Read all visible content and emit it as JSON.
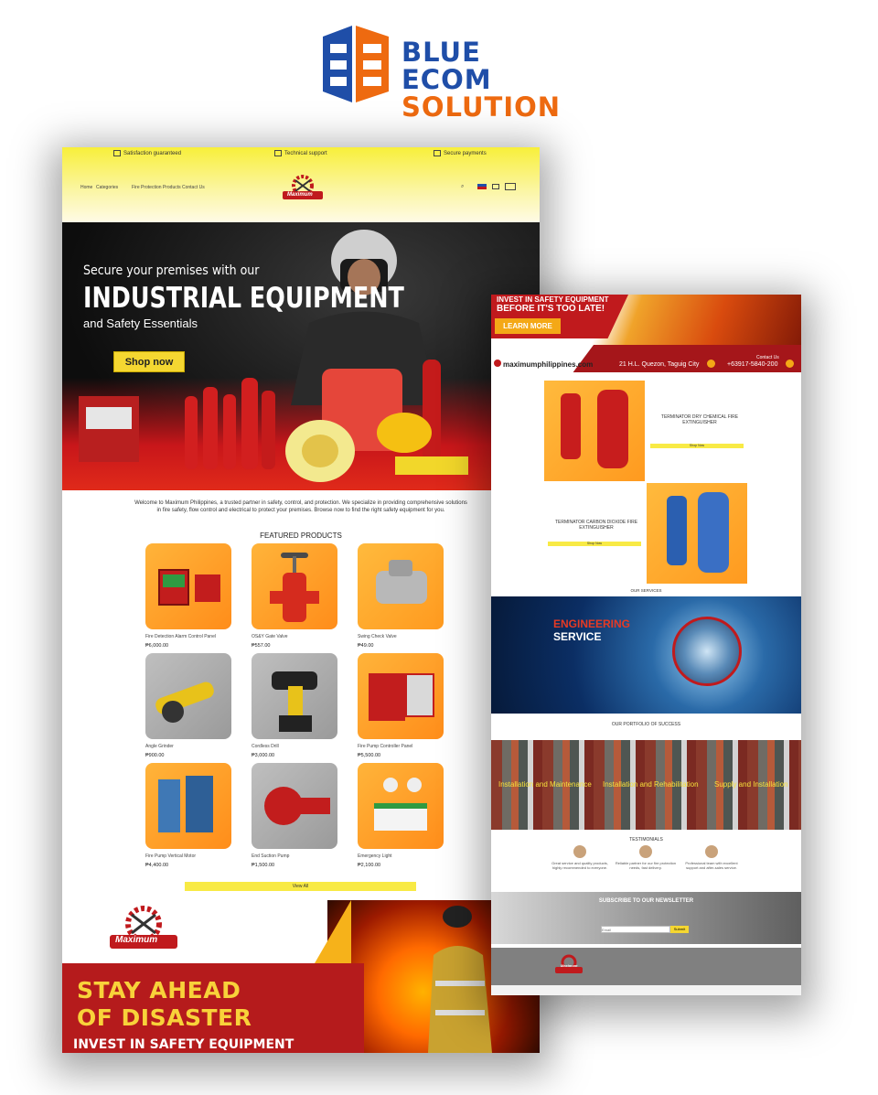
{
  "brand": {
    "line1": "BLUE ECOM",
    "line2": "SOLUTION",
    "color_blue": "#1f4ea8",
    "color_orange": "#ee6a10"
  },
  "left_page": {
    "trust_bar": [
      "Satisfaction guaranteed",
      "Technical support",
      "Secure payments"
    ],
    "nav": [
      "Home",
      "Categories",
      "Fire Protection Products",
      "Contact Us"
    ],
    "logo_text": "Maximum",
    "hero": {
      "line1": "Secure your premises with our",
      "line2": "INDUSTRIAL EQUIPMENT",
      "line3": "and Safety Essentials",
      "button": "Shop now"
    },
    "welcome": "Welcome to Maximum Philippines, a trusted partner in safety, control, and protection. We specialize in providing comprehensive solutions in fire safety, flow control and electrical to protect your premises. Browse now to find the right safety equipment for you.",
    "featured_title": "FEATURED PRODUCTS",
    "products": [
      {
        "name": "Fire Detection Alarm Control Panel",
        "price": "₱6,000.00",
        "icon": "alarm-panel-icon",
        "grey": false
      },
      {
        "name": "OS&Y Gate Valve",
        "price": "₱557.00",
        "icon": "gate-valve-icon",
        "grey": false
      },
      {
        "name": "Swing Check Valve",
        "price": "₱49.00",
        "icon": "check-valve-icon",
        "grey": true
      },
      {
        "name": "Angle Grinder",
        "price": "₱900.00",
        "icon": "grinder-icon",
        "grey": true
      },
      {
        "name": "Cordless Drill",
        "price": "₱3,000.00",
        "icon": "drill-icon",
        "grey": true
      },
      {
        "name": "Fire Pump Controller Panel",
        "price": "₱5,500.00",
        "icon": "pump-panel-icon",
        "grey": false
      },
      {
        "name": "Fire Pump Vertical Motor",
        "price": "₱4,400.00",
        "icon": "motor-icon",
        "grey": false
      },
      {
        "name": "End Suction Pump",
        "price": "₱1,500.00",
        "icon": "pump-icon",
        "grey": true
      },
      {
        "name": "Emergency Light",
        "price": "₱2,100.00",
        "icon": "emergency-light-icon",
        "grey": false
      }
    ],
    "view_all": "View All",
    "footer_banner": {
      "logo": "Maximum",
      "line1": "STAY AHEAD",
      "line2": "OF DISASTER",
      "line3": "INVEST IN SAFETY EQUIPMENT"
    }
  },
  "right_page": {
    "hero": {
      "line1": "INVEST IN SAFETY EQUIPMENT",
      "line2": "BEFORE IT'S TOO LATE!",
      "button": "LEARN MORE"
    },
    "contact": {
      "email": "maximumphilippines.com",
      "address": "21 H.L. Quezon, Taguig City",
      "contact_us": "Contact Us",
      "phone": "+63917-5840-200"
    },
    "product1": {
      "title": "TERMINATOR DRY CHEMICAL FIRE EXTINGUISHER",
      "button": "Shop Now"
    },
    "product2": {
      "title": "TERMINATOR CARBON DIOXIDE FIRE EXTINGUISHER",
      "button": "Shop Now"
    },
    "services_label": "OUR SERVICES",
    "services": {
      "title1": "ENGINEERING",
      "title2": "SERVICE"
    },
    "portfolio_title": "OUR PORTFOLIO OF SUCCESS",
    "portfolio": [
      "Installation and Maintenance",
      "Installation and Rehabilitation",
      "Supply and Installation"
    ],
    "testimonials_title": "TESTIMONIALS",
    "testimonials": [
      "Great service and quality products, highly recommended to everyone.",
      "Reliable partner for our fire protection needs, fast delivery.",
      "Professional team with excellent support and after-sales service."
    ],
    "newsletter": {
      "title": "SUBSCRIBE TO OUR NEWSLETTER",
      "placeholder": "Email",
      "button": "Submit"
    },
    "footer_logo": "Maximum"
  }
}
